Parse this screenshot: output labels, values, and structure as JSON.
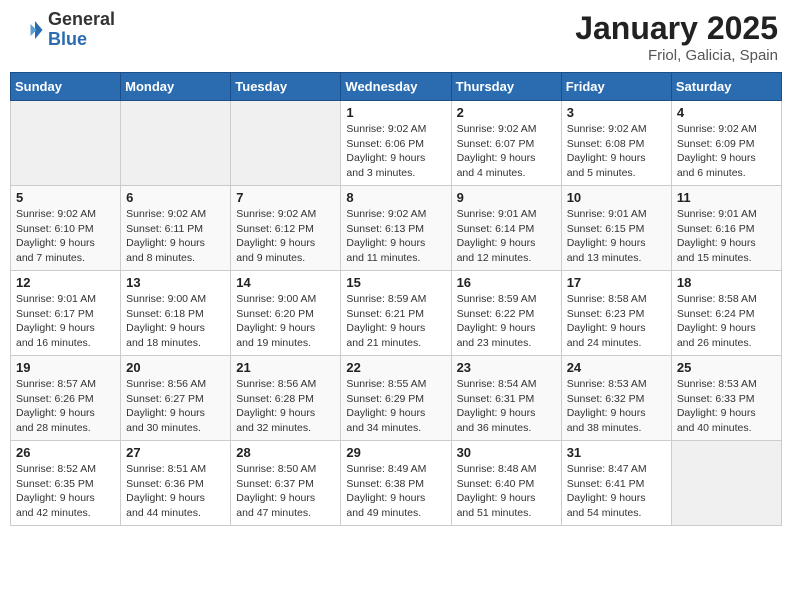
{
  "logo": {
    "general": "General",
    "blue": "Blue"
  },
  "header": {
    "month": "January 2025",
    "location": "Friol, Galicia, Spain"
  },
  "weekdays": [
    "Sunday",
    "Monday",
    "Tuesday",
    "Wednesday",
    "Thursday",
    "Friday",
    "Saturday"
  ],
  "weeks": [
    [
      {
        "day": "",
        "info": ""
      },
      {
        "day": "",
        "info": ""
      },
      {
        "day": "",
        "info": ""
      },
      {
        "day": "1",
        "info": "Sunrise: 9:02 AM\nSunset: 6:06 PM\nDaylight: 9 hours\nand 3 minutes."
      },
      {
        "day": "2",
        "info": "Sunrise: 9:02 AM\nSunset: 6:07 PM\nDaylight: 9 hours\nand 4 minutes."
      },
      {
        "day": "3",
        "info": "Sunrise: 9:02 AM\nSunset: 6:08 PM\nDaylight: 9 hours\nand 5 minutes."
      },
      {
        "day": "4",
        "info": "Sunrise: 9:02 AM\nSunset: 6:09 PM\nDaylight: 9 hours\nand 6 minutes."
      }
    ],
    [
      {
        "day": "5",
        "info": "Sunrise: 9:02 AM\nSunset: 6:10 PM\nDaylight: 9 hours\nand 7 minutes."
      },
      {
        "day": "6",
        "info": "Sunrise: 9:02 AM\nSunset: 6:11 PM\nDaylight: 9 hours\nand 8 minutes."
      },
      {
        "day": "7",
        "info": "Sunrise: 9:02 AM\nSunset: 6:12 PM\nDaylight: 9 hours\nand 9 minutes."
      },
      {
        "day": "8",
        "info": "Sunrise: 9:02 AM\nSunset: 6:13 PM\nDaylight: 9 hours\nand 11 minutes."
      },
      {
        "day": "9",
        "info": "Sunrise: 9:01 AM\nSunset: 6:14 PM\nDaylight: 9 hours\nand 12 minutes."
      },
      {
        "day": "10",
        "info": "Sunrise: 9:01 AM\nSunset: 6:15 PM\nDaylight: 9 hours\nand 13 minutes."
      },
      {
        "day": "11",
        "info": "Sunrise: 9:01 AM\nSunset: 6:16 PM\nDaylight: 9 hours\nand 15 minutes."
      }
    ],
    [
      {
        "day": "12",
        "info": "Sunrise: 9:01 AM\nSunset: 6:17 PM\nDaylight: 9 hours\nand 16 minutes."
      },
      {
        "day": "13",
        "info": "Sunrise: 9:00 AM\nSunset: 6:18 PM\nDaylight: 9 hours\nand 18 minutes."
      },
      {
        "day": "14",
        "info": "Sunrise: 9:00 AM\nSunset: 6:20 PM\nDaylight: 9 hours\nand 19 minutes."
      },
      {
        "day": "15",
        "info": "Sunrise: 8:59 AM\nSunset: 6:21 PM\nDaylight: 9 hours\nand 21 minutes."
      },
      {
        "day": "16",
        "info": "Sunrise: 8:59 AM\nSunset: 6:22 PM\nDaylight: 9 hours\nand 23 minutes."
      },
      {
        "day": "17",
        "info": "Sunrise: 8:58 AM\nSunset: 6:23 PM\nDaylight: 9 hours\nand 24 minutes."
      },
      {
        "day": "18",
        "info": "Sunrise: 8:58 AM\nSunset: 6:24 PM\nDaylight: 9 hours\nand 26 minutes."
      }
    ],
    [
      {
        "day": "19",
        "info": "Sunrise: 8:57 AM\nSunset: 6:26 PM\nDaylight: 9 hours\nand 28 minutes."
      },
      {
        "day": "20",
        "info": "Sunrise: 8:56 AM\nSunset: 6:27 PM\nDaylight: 9 hours\nand 30 minutes."
      },
      {
        "day": "21",
        "info": "Sunrise: 8:56 AM\nSunset: 6:28 PM\nDaylight: 9 hours\nand 32 minutes."
      },
      {
        "day": "22",
        "info": "Sunrise: 8:55 AM\nSunset: 6:29 PM\nDaylight: 9 hours\nand 34 minutes."
      },
      {
        "day": "23",
        "info": "Sunrise: 8:54 AM\nSunset: 6:31 PM\nDaylight: 9 hours\nand 36 minutes."
      },
      {
        "day": "24",
        "info": "Sunrise: 8:53 AM\nSunset: 6:32 PM\nDaylight: 9 hours\nand 38 minutes."
      },
      {
        "day": "25",
        "info": "Sunrise: 8:53 AM\nSunset: 6:33 PM\nDaylight: 9 hours\nand 40 minutes."
      }
    ],
    [
      {
        "day": "26",
        "info": "Sunrise: 8:52 AM\nSunset: 6:35 PM\nDaylight: 9 hours\nand 42 minutes."
      },
      {
        "day": "27",
        "info": "Sunrise: 8:51 AM\nSunset: 6:36 PM\nDaylight: 9 hours\nand 44 minutes."
      },
      {
        "day": "28",
        "info": "Sunrise: 8:50 AM\nSunset: 6:37 PM\nDaylight: 9 hours\nand 47 minutes."
      },
      {
        "day": "29",
        "info": "Sunrise: 8:49 AM\nSunset: 6:38 PM\nDaylight: 9 hours\nand 49 minutes."
      },
      {
        "day": "30",
        "info": "Sunrise: 8:48 AM\nSunset: 6:40 PM\nDaylight: 9 hours\nand 51 minutes."
      },
      {
        "day": "31",
        "info": "Sunrise: 8:47 AM\nSunset: 6:41 PM\nDaylight: 9 hours\nand 54 minutes."
      },
      {
        "day": "",
        "info": ""
      }
    ]
  ]
}
